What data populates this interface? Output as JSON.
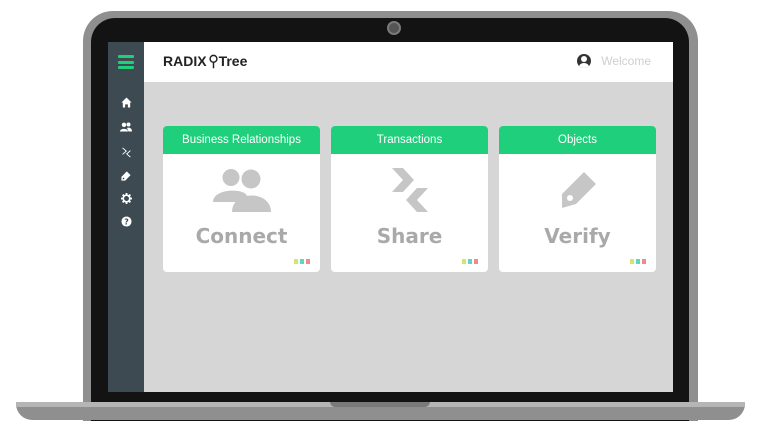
{
  "brand": {
    "name_left": "RADIX",
    "name_right": "Tree"
  },
  "user": {
    "label": "Welcome"
  },
  "sidebar": {
    "items": [
      {
        "icon": "menu-icon"
      },
      {
        "icon": "home-icon"
      },
      {
        "icon": "users-icon"
      },
      {
        "icon": "transfer-icon"
      },
      {
        "icon": "tag-icon"
      },
      {
        "icon": "gear-icon"
      },
      {
        "icon": "help-icon"
      }
    ]
  },
  "cards": [
    {
      "header": "Business Relationships",
      "title": "Connect",
      "icon": "users-icon"
    },
    {
      "header": "Transactions",
      "title": "Share",
      "icon": "transfer-icon"
    },
    {
      "header": "Objects",
      "title": "Verify",
      "icon": "tag-icon"
    }
  ],
  "colors": {
    "accent": "#1fcf7c",
    "sidebar": "#3e4a52",
    "screen_bg": "#d6d6d6",
    "card_title": "#a9a9a9",
    "status_dots": [
      "#d7e36a",
      "#5ad8c0",
      "#ef8a8a"
    ]
  }
}
